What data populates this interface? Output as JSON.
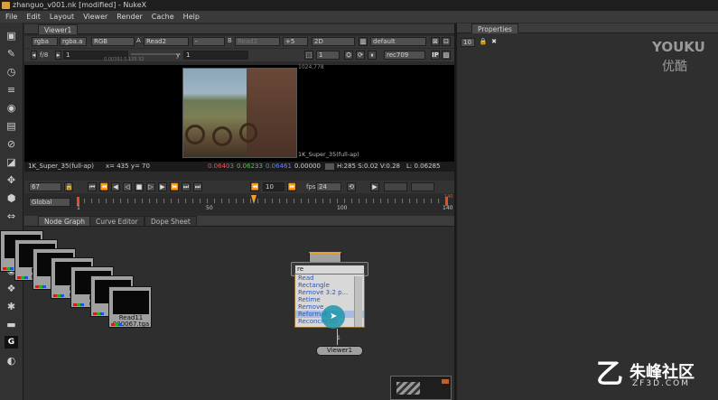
{
  "window": {
    "title": "zhanguo_v001.nk [modified] - NukeX"
  },
  "menu": [
    "File",
    "Edit",
    "Layout",
    "Viewer",
    "Render",
    "Cache",
    "Help"
  ],
  "viewer": {
    "tab": "Viewer1",
    "row1": {
      "channels": "rgba",
      "alpha": "rgba.a",
      "colorspace": "RGB",
      "a_label": "A",
      "a_input": "Read2",
      "dash": "-",
      "b_label": "B",
      "b_input": "Read2",
      "gain": "+5",
      "mode": "2D",
      "lut": "default"
    },
    "row2": {
      "fstop": "f/8",
      "gain_value": "1",
      "gain_ticks": "0.00391  0.125  32",
      "y_label": "y",
      "y_value": "1",
      "proxy": "1",
      "output": "rec709"
    },
    "resolution": "1024,778",
    "format_label": "1K_Super_35(full-ap)",
    "info": {
      "format": "1K_Super_35(full-ap)",
      "coords": "x= 435 y=  70",
      "r": "0.06403",
      "g": "0.06233",
      "b": "0.06461",
      "a": "0.00000",
      "hsv": "H:285 S:0.02 V:0.28",
      "lum": "L: 0.06285"
    }
  },
  "timeline": {
    "frame": "67",
    "step": "10",
    "fps_label": "fps",
    "fps": "24",
    "range": "Global",
    "ticks": [
      "1",
      "50",
      "100",
      "140"
    ],
    "end_top": "140",
    "playhead": "67"
  },
  "tabs": {
    "node_graph": "Node Graph",
    "curve_editor": "Curve Editor",
    "dope_sheet": "Dope Sheet"
  },
  "properties": {
    "tab": "Properties",
    "count": "10"
  },
  "nodes": {
    "read_stack": [
      {
        "name": "Rea",
        "file": "000"
      },
      {
        "name": "Rea",
        "file": "000"
      },
      {
        "name": "Re",
        "file": "00"
      },
      {
        "name": "Re",
        "file": "00"
      },
      {
        "name": "Re",
        "file": "00"
      },
      {
        "name": "Re",
        "file": "00"
      },
      {
        "name": "Read11",
        "file": "000067.tga"
      }
    ],
    "viewer_node": "Viewer1",
    "viewer_port": "1"
  },
  "tab_menu": {
    "input": "re",
    "items": [
      "Read",
      "Rectangle",
      "Remove 3:2 p...",
      "Retime",
      "Remove",
      "Reformat",
      "Reconcile3D"
    ],
    "selected_index": 5
  },
  "watermarks": {
    "youku": "YOUKU",
    "youku_cn": "优酷",
    "zf": "朱峰社区",
    "zf_url": "ZF3D.COM"
  },
  "colors": {
    "bg": "#2b2b2b",
    "accent": "#e8a030",
    "red_value": "#ff5050",
    "green_value": "#40d040",
    "blue_value": "#6080ff"
  }
}
